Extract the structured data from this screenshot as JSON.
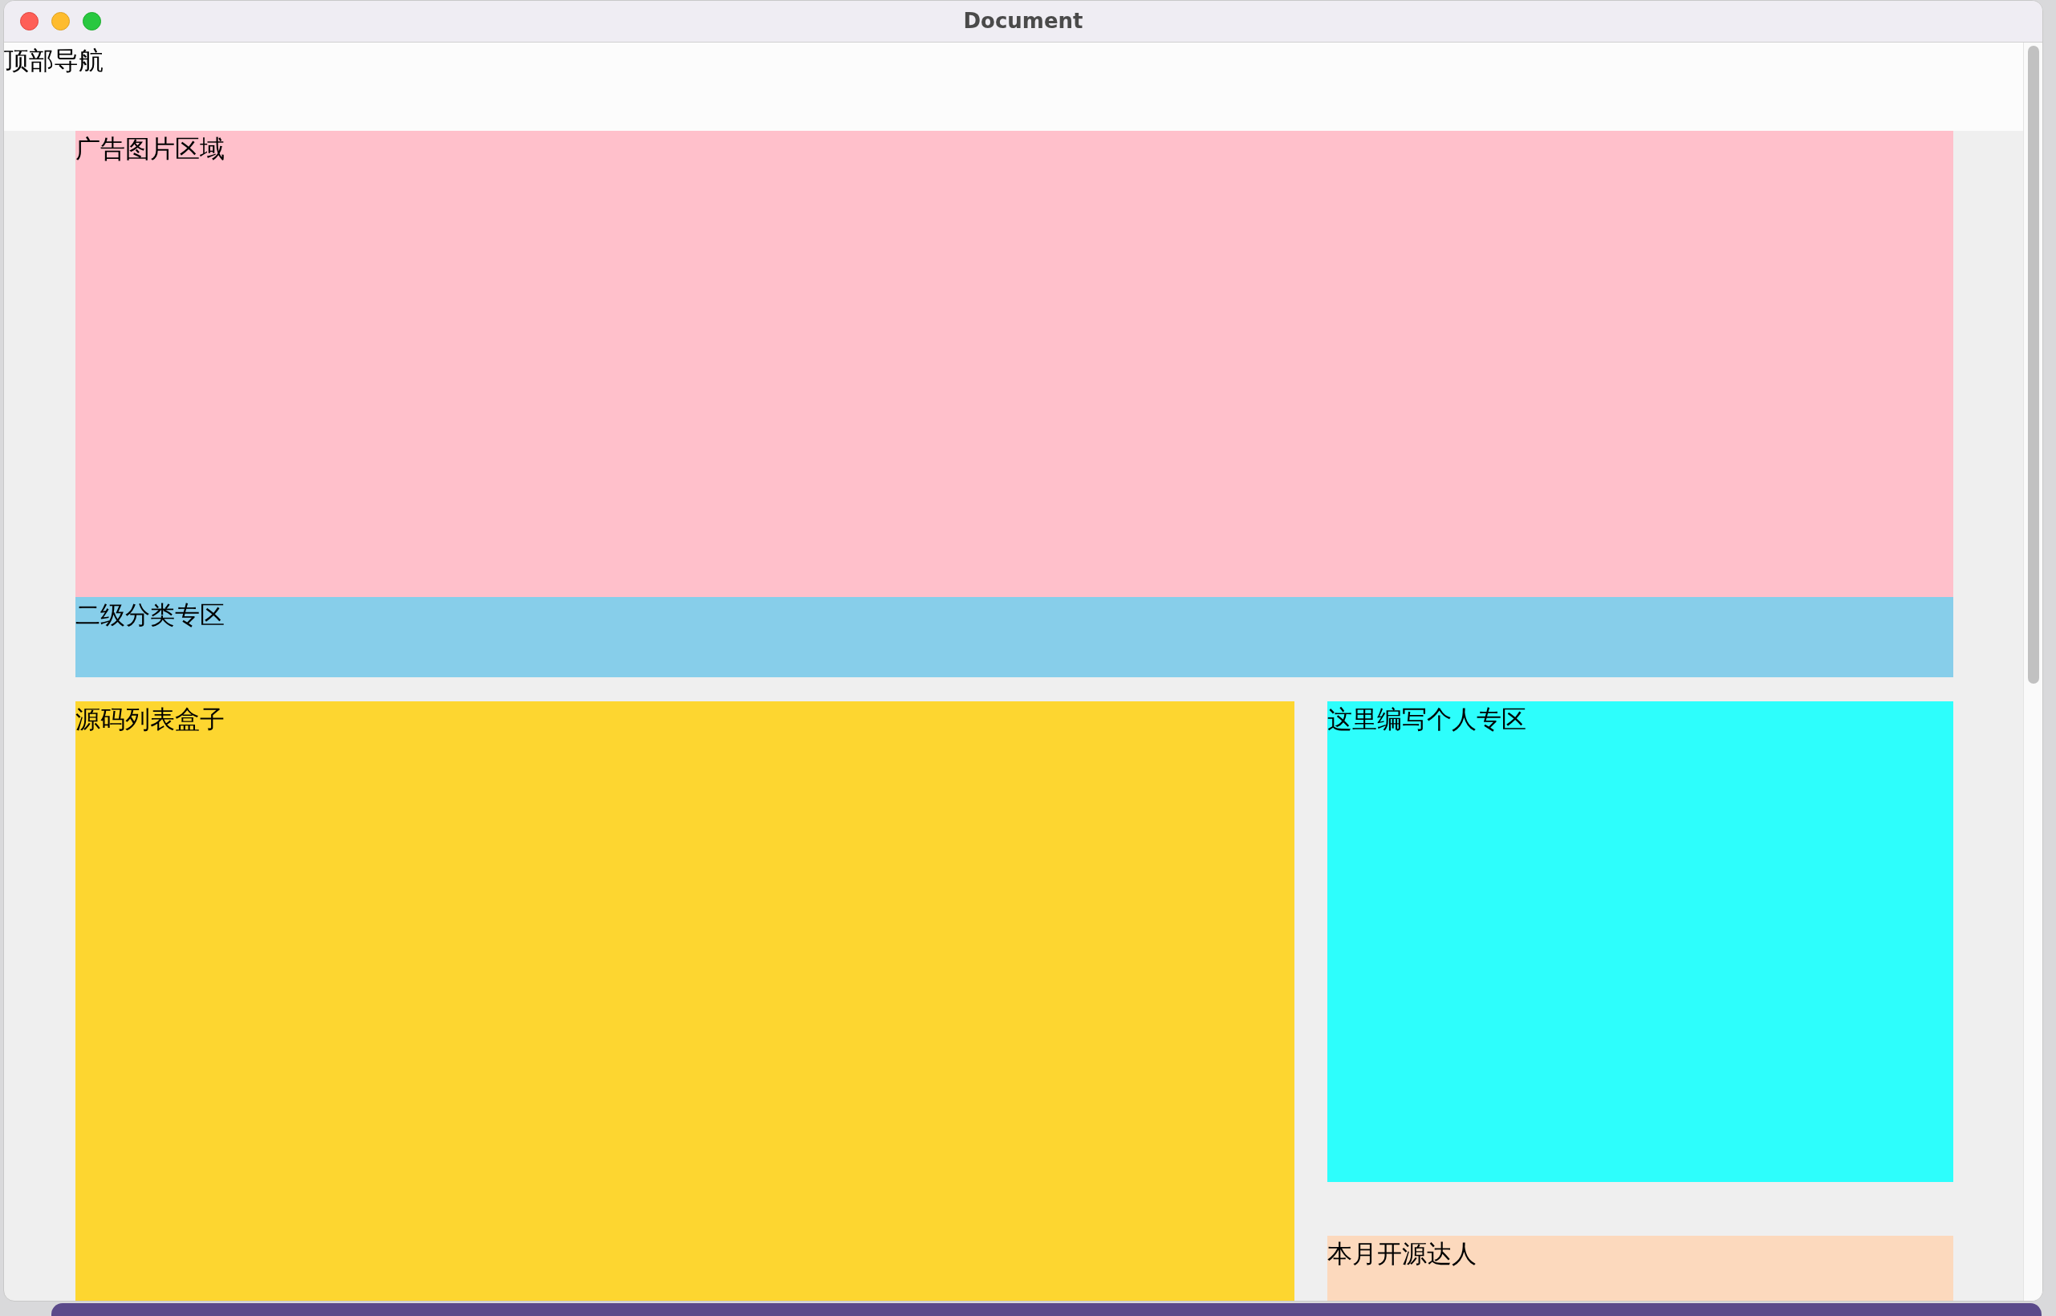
{
  "window": {
    "title": "Document"
  },
  "top_nav": {
    "label": "顶部导航"
  },
  "banner": {
    "label": "广告图片区域"
  },
  "subcategory": {
    "label": "二级分类专区"
  },
  "source_list": {
    "label": "源码列表盒子"
  },
  "side_panels": [
    {
      "label": "这里编写个人专区",
      "color": "#2dfefc"
    },
    {
      "label": "本月开源达人",
      "color": "#fcd9bd"
    }
  ]
}
